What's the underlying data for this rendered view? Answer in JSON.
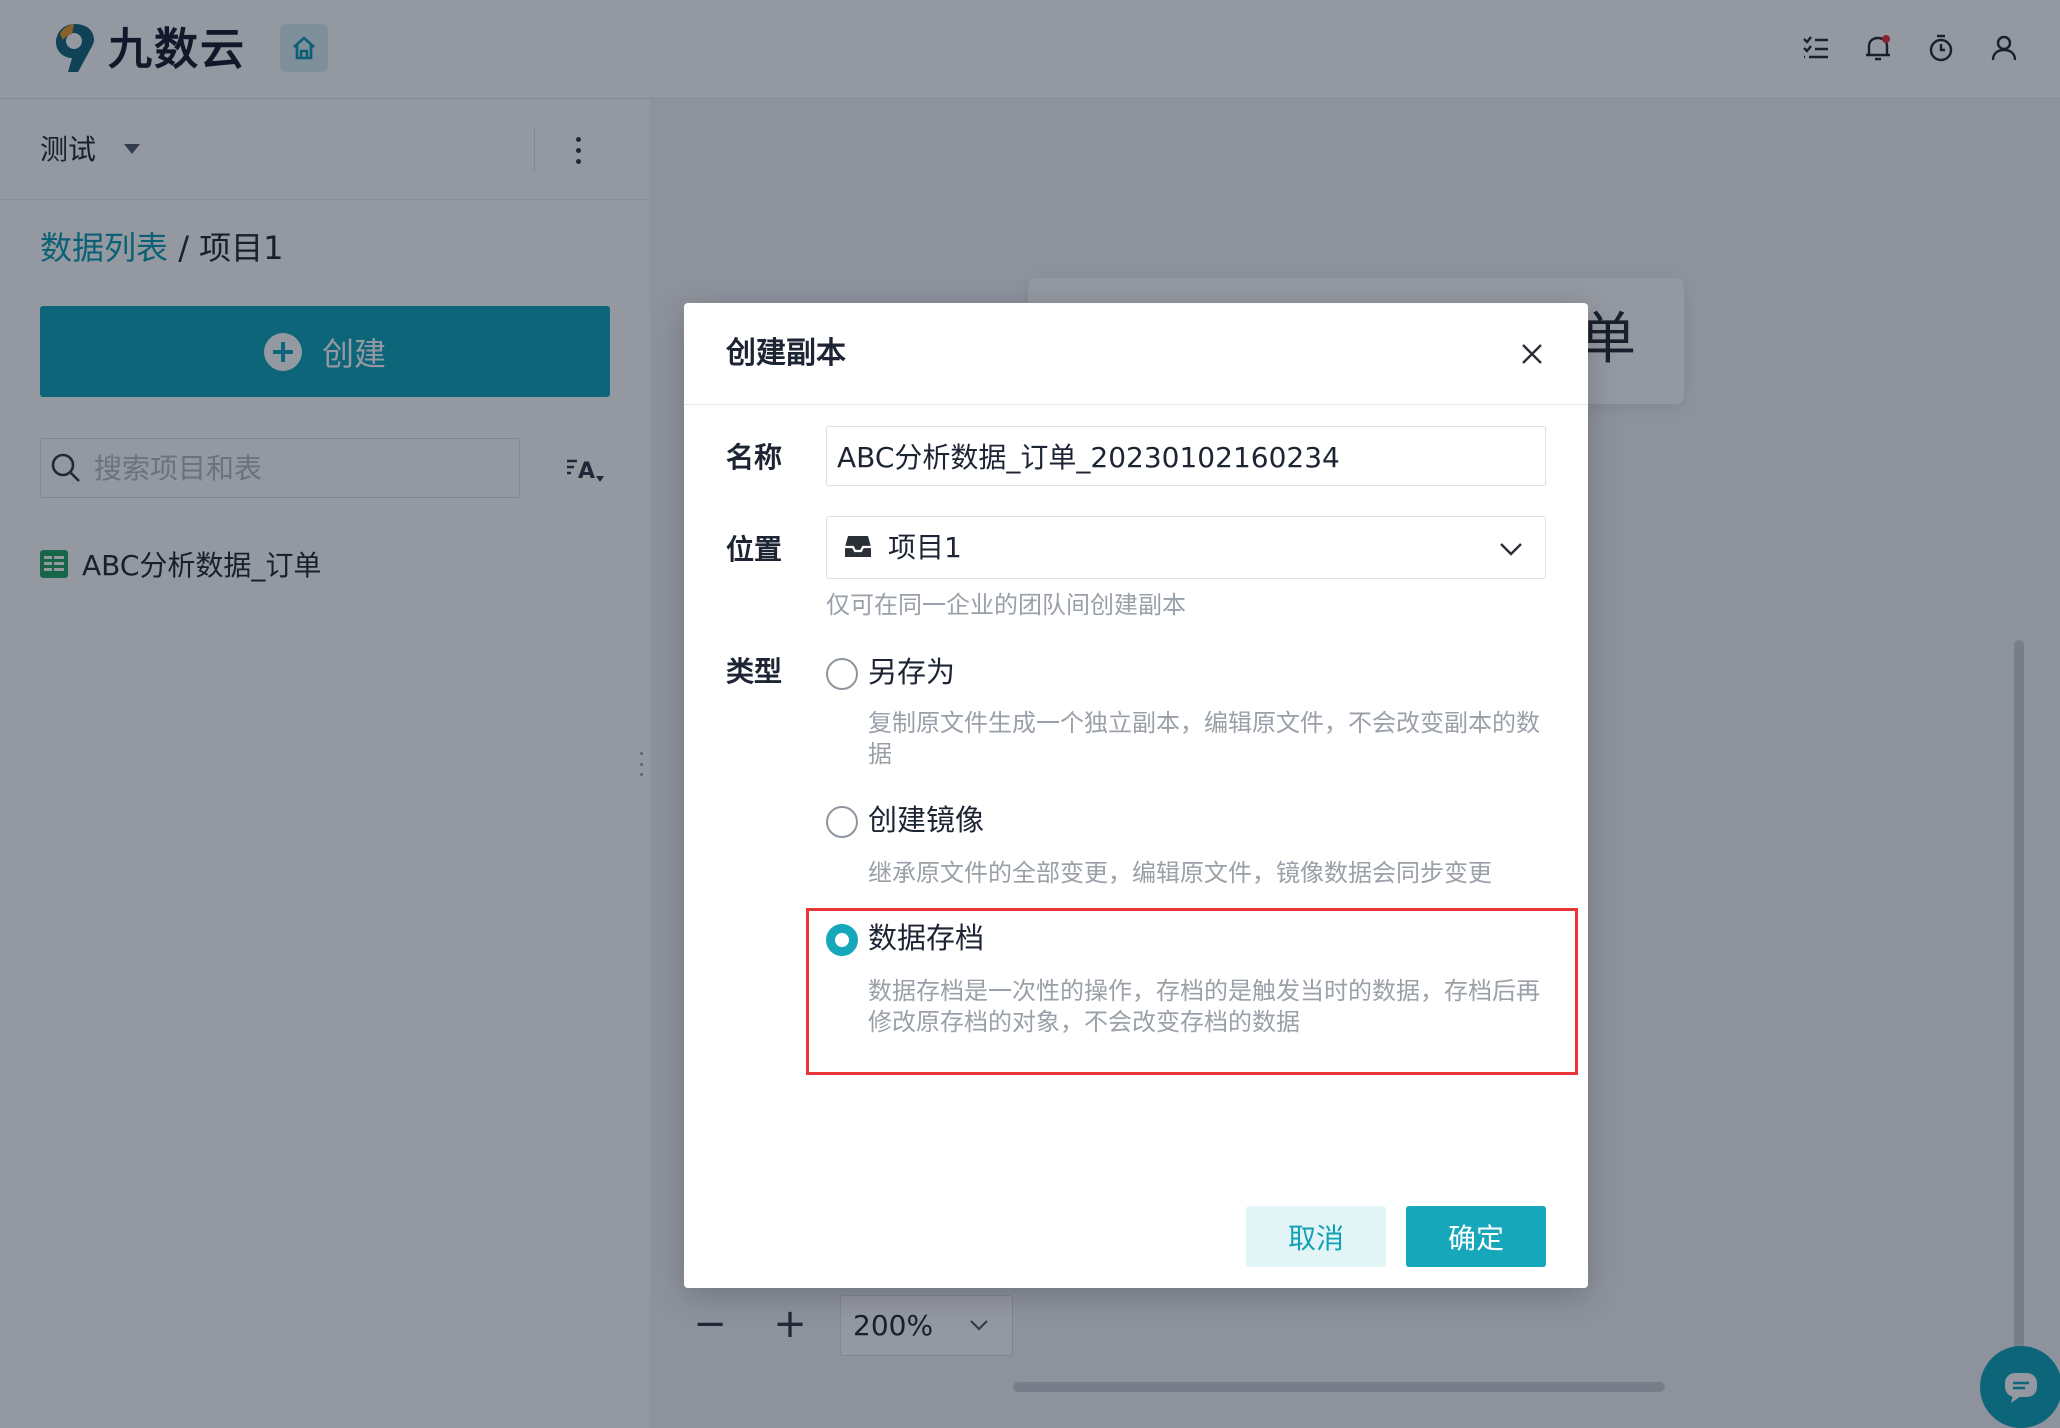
{
  "app": {
    "logo_text": "九数云"
  },
  "sidebar": {
    "workspace": "测试",
    "breadcrumb_link": "数据列表",
    "breadcrumb_separator": " / ",
    "breadcrumb_current": "项目1",
    "create_label": "创建",
    "search_placeholder": "搜索项目和表",
    "sort_label": "A",
    "items": [
      {
        "label": "ABC分析数据_订单",
        "icon": "table-icon"
      }
    ]
  },
  "main": {
    "card_text": "单",
    "zoom_value": "200%"
  },
  "dialog": {
    "title": "创建副本",
    "name_label": "名称",
    "name_value": "ABC分析数据_订单_20230102160234",
    "location_label": "位置",
    "location_value": "项目1",
    "location_hint": "仅可在同一企业的团队间创建副本",
    "type_label": "类型",
    "options": [
      {
        "label": "另存为",
        "description": "复制原文件生成一个独立副本，编辑原文件，不会改变副本的数据",
        "checked": false
      },
      {
        "label": "创建镜像",
        "description": "继承原文件的全部变更，编辑原文件，镜像数据会同步变更",
        "checked": false
      },
      {
        "label": "数据存档",
        "description": "数据存档是一次性的操作，存档的是触发当时的数据，存档后再修改原存档的对象，不会改变存档的数据",
        "checked": true
      }
    ],
    "cancel_label": "取消",
    "ok_label": "确定"
  },
  "colors": {
    "accent": "#16a7ba",
    "highlight": "#e8363b"
  }
}
